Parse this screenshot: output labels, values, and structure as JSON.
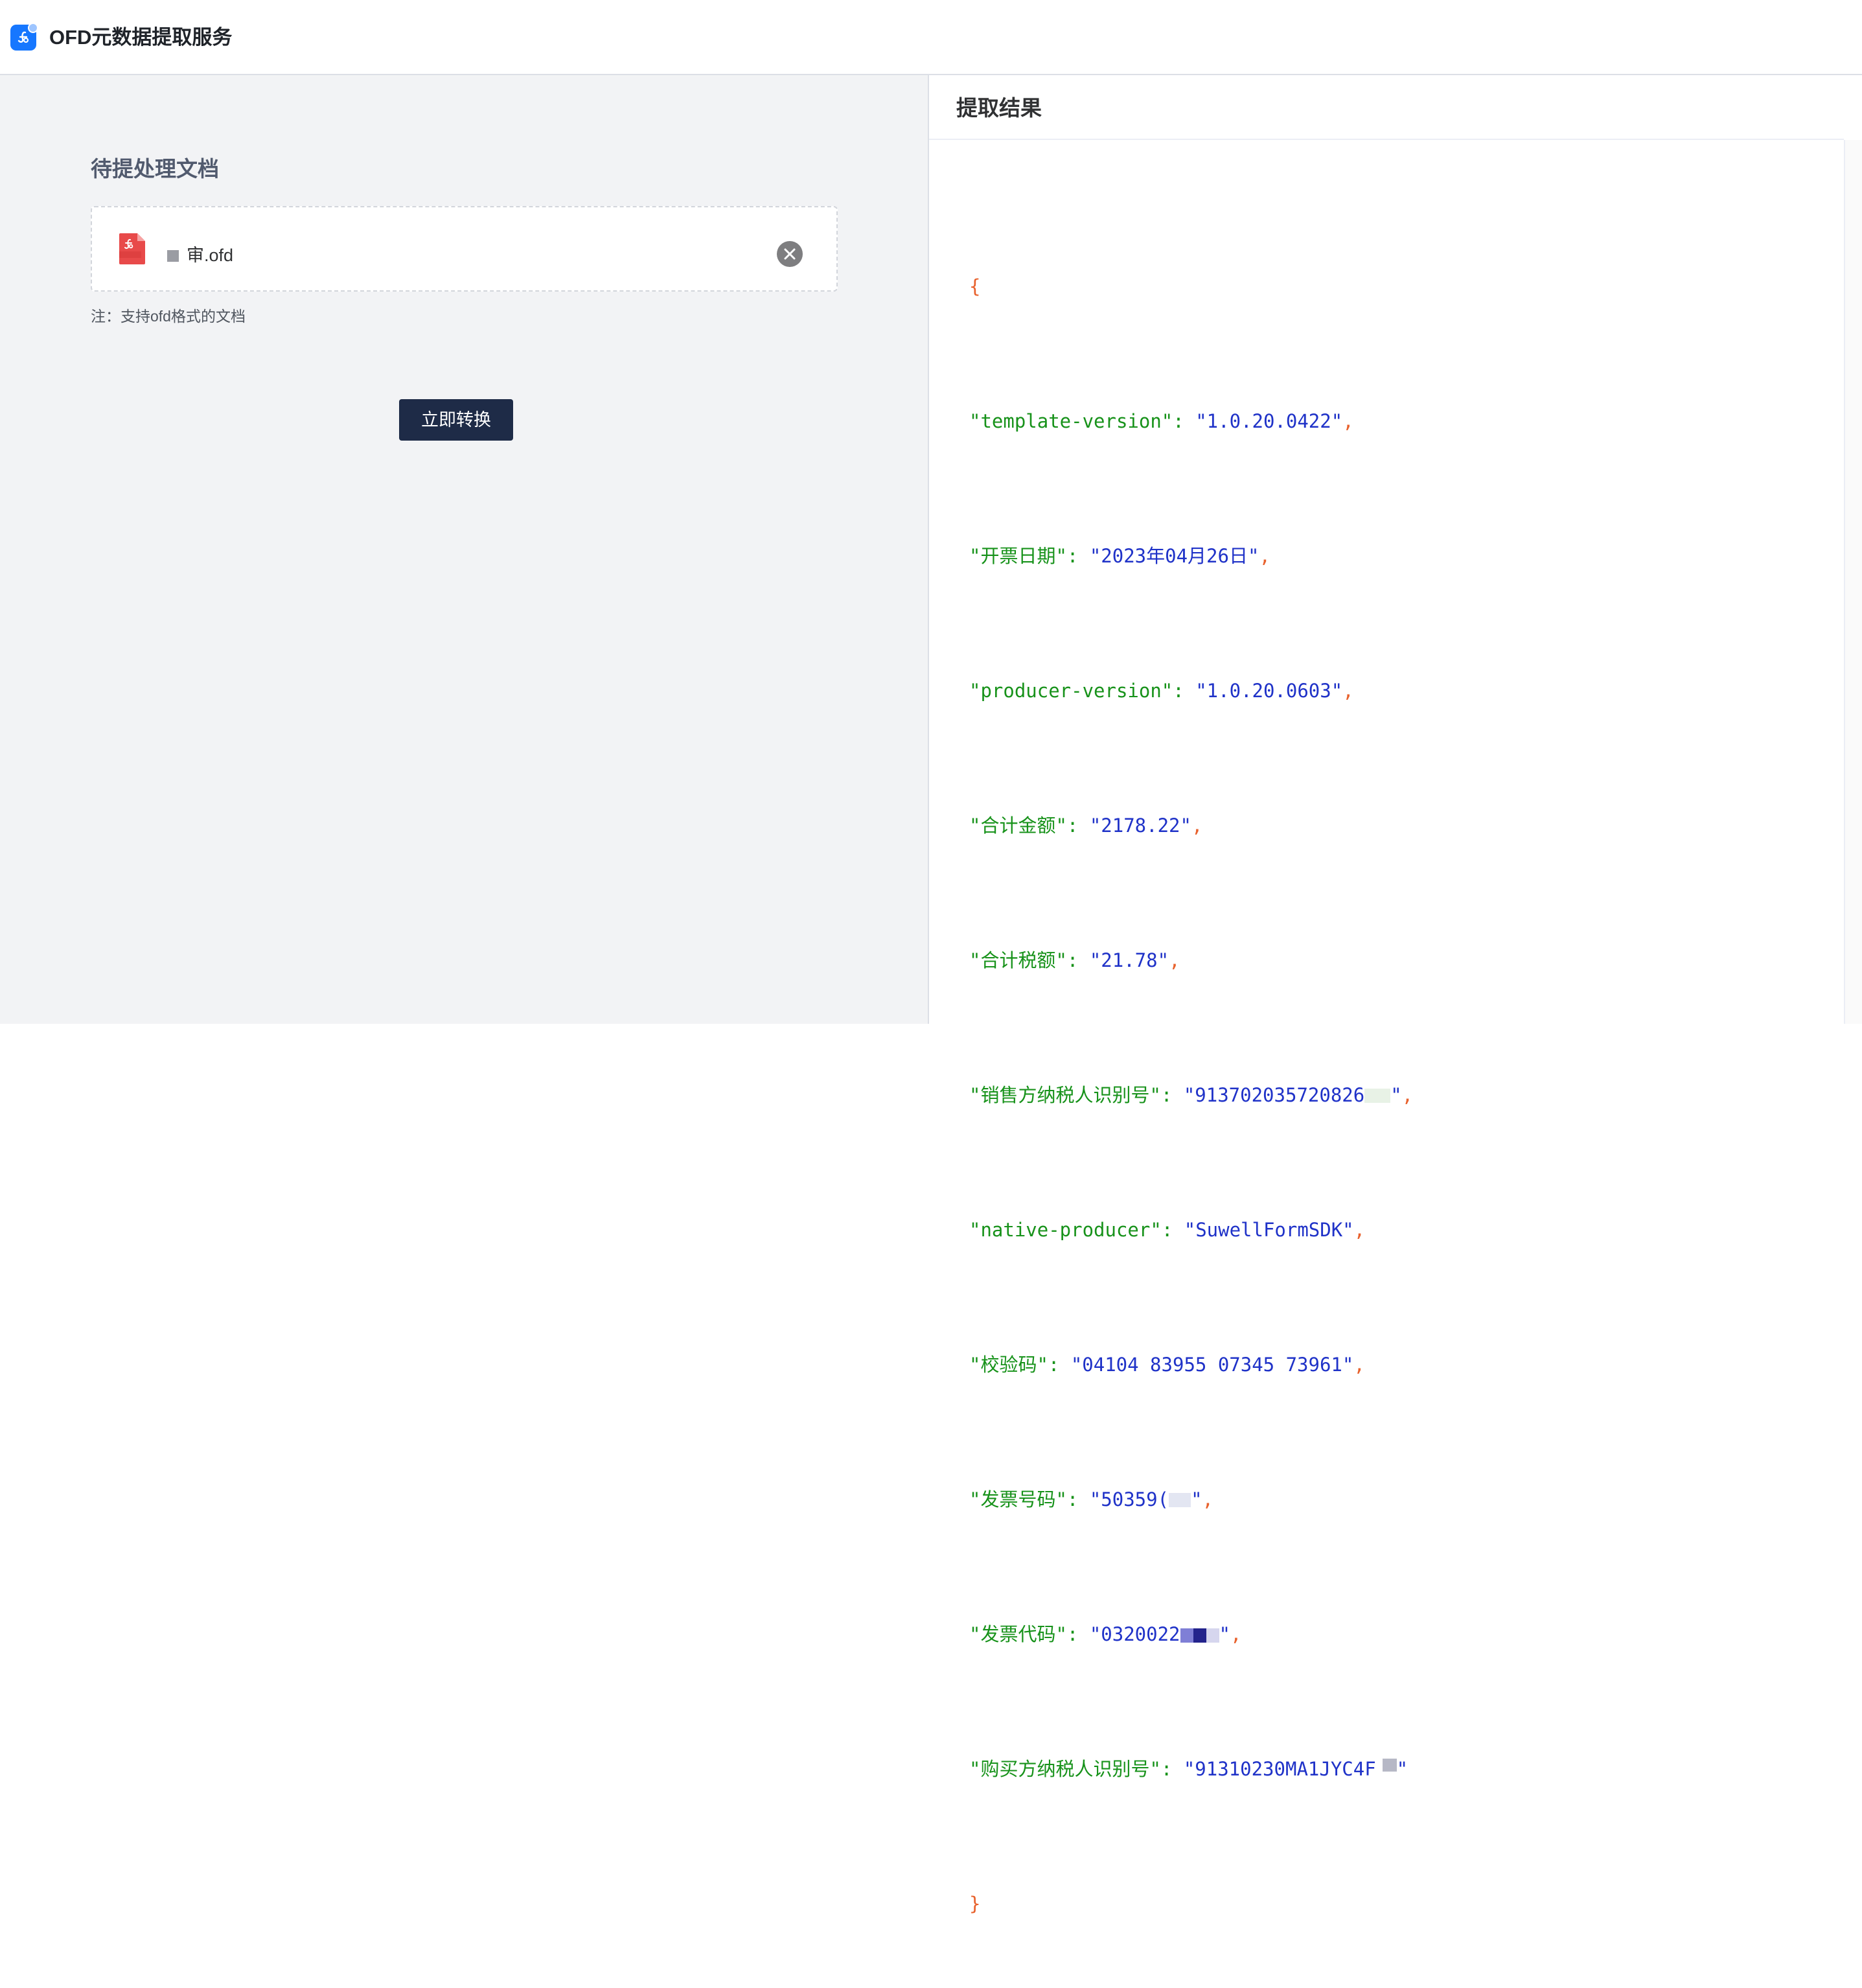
{
  "app": {
    "title": "OFD元数据提取服务"
  },
  "left_panel": {
    "section_title": "待提处理文档",
    "file": {
      "name": "审.ofd",
      "remove_icon": "close-circle-icon"
    },
    "note": "注：支持ofd格式的文档",
    "convert_button": "立即转换"
  },
  "right_panel": {
    "title": "提取结果",
    "json_open": "{",
    "json_close": "}",
    "entries": [
      {
        "key": "\"template-version\"",
        "value": "\"1.0.20.0422\"",
        "comma": ","
      },
      {
        "key": "\"开票日期\"",
        "value": "\"2023年04月26日\"",
        "comma": ","
      },
      {
        "key": "\"producer-version\"",
        "value": "\"1.0.20.0603\"",
        "comma": ","
      },
      {
        "key": "\"合计金额\"",
        "value": "\"2178.22\"",
        "comma": ","
      },
      {
        "key": "\"合计税额\"",
        "value": "\"21.78\"",
        "comma": ","
      },
      {
        "key": "\"销售方纳税人识别号\"",
        "value_prefix": "\"913702035720826",
        "value_suffix": "\"",
        "comma": ","
      },
      {
        "key": "\"native-producer\"",
        "value": "\"SuwellFormSDK\"",
        "comma": ","
      },
      {
        "key": "\"校验码\"",
        "value": "\"04104 83955 07345 73961\"",
        "comma": ","
      },
      {
        "key": "\"发票号码\"",
        "value_prefix": "\"50359(",
        "value_suffix": "\"",
        "comma": ","
      },
      {
        "key": "\"发票代码\"",
        "value_prefix": "\"0320022",
        "value_suffix": "\"",
        "comma": ","
      },
      {
        "key": "\"购买方纳税人识别号\"",
        "value_prefix": "\"91310230MA1JYC4F",
        "value_suffix": "\"",
        "comma": ""
      }
    ]
  },
  "colors": {
    "brand": "#1677ff",
    "button": "#1e2b47",
    "json_key": "#17921a",
    "json_value": "#1f32c8",
    "json_punct": "#e8612c"
  }
}
